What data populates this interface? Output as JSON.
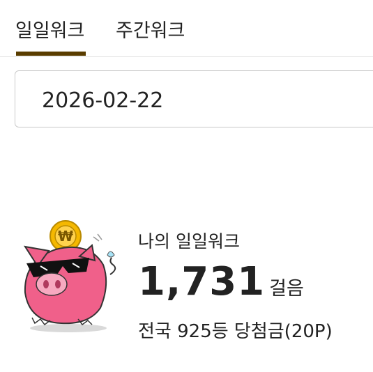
{
  "tabs": [
    {
      "label": "일일워크",
      "active": true
    },
    {
      "label": "주간워크",
      "active": false
    }
  ],
  "date_picker": {
    "value": "2026-02-22"
  },
  "summary": {
    "label": "나의 일일워크",
    "steps": "1,731",
    "steps_unit": "걸음",
    "rank_prefix": "전국",
    "rank": "925등",
    "prize": "당첨금(20P)"
  },
  "icons": {
    "mascot": "pig-coin-icon",
    "coin_symbol": "₩"
  },
  "colors": {
    "tab_underline": "#5a3d00",
    "pig_body": "#f0608a",
    "coin": "#f5b800",
    "date_border": "#c9c9c9"
  }
}
